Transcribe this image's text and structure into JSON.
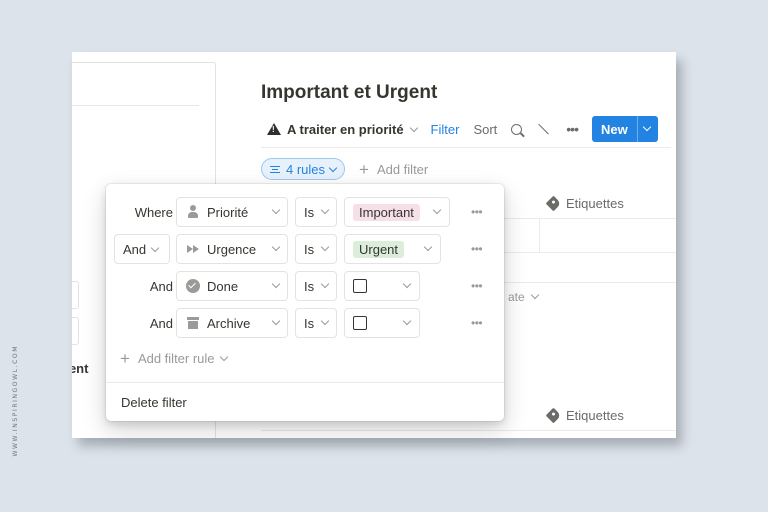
{
  "watermark": "WWW.INSPIRINGOWL.COM",
  "page": {
    "title": "Important et Urgent"
  },
  "left_panel": {
    "partial_text": "gent"
  },
  "toolbar": {
    "view_name": "A traiter en priorité",
    "filter_label": "Filter",
    "sort_label": "Sort",
    "new_label": "New"
  },
  "filter_bar": {
    "rules_label": "4 rules",
    "add_filter_label": "Add filter"
  },
  "table": {
    "etiquettes_header": "Etiquettes",
    "partial_text": "ate"
  },
  "filter_popup": {
    "rules": [
      {
        "conjunction": "Where",
        "field": "Priorité",
        "field_icon": "person-icon",
        "operator": "Is",
        "value": "Important",
        "value_color": "#f5e0e9"
      },
      {
        "conjunction": "And",
        "field": "Urgence",
        "field_icon": "fast-forward-icon",
        "operator": "Is",
        "value": "Urgent",
        "value_color": "#dbeddb"
      },
      {
        "conjunction": "And",
        "field": "Done",
        "field_icon": "check-circle-icon",
        "operator": "Is",
        "value": "unchecked"
      },
      {
        "conjunction": "And",
        "field": "Archive",
        "field_icon": "archive-icon",
        "operator": "Is",
        "value": "unchecked"
      }
    ],
    "add_rule_label": "Add filter rule",
    "delete_label": "Delete filter"
  },
  "colors": {
    "accent": "#2383e2",
    "background": "#dde3ea"
  }
}
